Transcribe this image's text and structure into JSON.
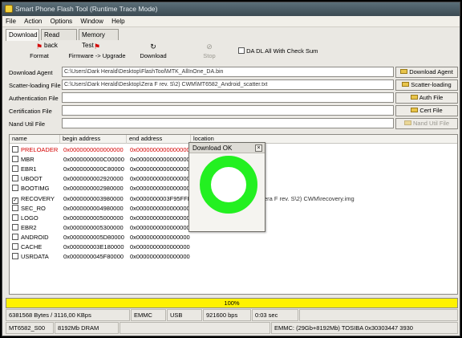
{
  "window": {
    "title": "Smart Phone Flash Tool (Runtime Trace Mode)"
  },
  "menu": [
    "File",
    "Action",
    "Options",
    "Window",
    "Help"
  ],
  "tabs": [
    "Download",
    "Read back",
    "Memory Test"
  ],
  "toolbar": {
    "format": "Format",
    "firmware_upgrade": "Firmware -> Upgrade",
    "download": "Download",
    "stop": "Stop",
    "da_dl_all": "DA DL All With Check Sum"
  },
  "fields": [
    {
      "label": "Download Agent",
      "value": "C:\\Users\\Dark Herald\\Desktop\\FlashTool\\MTK_AllInOne_DA.bin",
      "button": "Download Agent"
    },
    {
      "label": "Scatter-loading File",
      "value": "C:\\Users\\Dark Herald\\Desktop\\Zera F rev. S\\2) CWM\\MT6582_Android_scatter.txt",
      "button": "Scatter-loading"
    },
    {
      "label": "Authentication File",
      "value": "",
      "button": "Auth File"
    },
    {
      "label": "Certification File",
      "value": "",
      "button": "Cert File"
    },
    {
      "label": "Nand Util File",
      "value": "",
      "button": "Nand Util File"
    }
  ],
  "list": {
    "columns": [
      "name",
      "begin address",
      "end address",
      "location"
    ],
    "rows": [
      {
        "name": "PRELOADER",
        "begin": "0x0000000000000000",
        "end": "0x0000000000000000",
        "location": "",
        "checked": false,
        "red": true
      },
      {
        "name": "MBR",
        "begin": "0x0000000000C00000",
        "end": "0x0000000000000000",
        "location": "",
        "checked": false,
        "red": false
      },
      {
        "name": "EBR1",
        "begin": "0x0000000000C80000",
        "end": "0x0000000000000000",
        "location": "",
        "checked": false,
        "red": false
      },
      {
        "name": "UBOOT",
        "begin": "0x0000000002920000",
        "end": "0x0000000000000000",
        "location": "",
        "checked": false,
        "red": false
      },
      {
        "name": "BOOTIMG",
        "begin": "0x0000000002980000",
        "end": "0x0000000000000000",
        "location": "",
        "checked": false,
        "red": false
      },
      {
        "name": "RECOVERY",
        "begin": "0x0000000003980000",
        "end": "0x0000000003F95FFF",
        "location": "op\\Zera F rev. S\\2) CWM\\recovery.img",
        "checked": true,
        "red": false
      },
      {
        "name": "SEC_RO",
        "begin": "0x0000000004980000",
        "end": "0x0000000000000000",
        "location": "",
        "checked": false,
        "red": false
      },
      {
        "name": "LOGO",
        "begin": "0x0000000005000000",
        "end": "0x0000000000000000",
        "location": "",
        "checked": false,
        "red": false
      },
      {
        "name": "EBR2",
        "begin": "0x0000000005300000",
        "end": "0x0000000000000000",
        "location": "",
        "checked": false,
        "red": false
      },
      {
        "name": "ANDROID",
        "begin": "0x0000000005D80000",
        "end": "0x0000000000000000",
        "location": "",
        "checked": false,
        "red": false
      },
      {
        "name": "CACHE",
        "begin": "0x000000003E180000",
        "end": "0x0000000000000000",
        "location": "",
        "checked": false,
        "red": false
      },
      {
        "name": "USRDATA",
        "begin": "0x0000000045F80000",
        "end": "0x0000000000000000",
        "location": "",
        "checked": false,
        "red": false
      }
    ]
  },
  "dialog": {
    "title": "Download OK",
    "ring_color": "#23f021"
  },
  "progress": {
    "text": "100%",
    "value": 1.0,
    "color": "#fff200"
  },
  "status1": {
    "bytes": "6381568 Bytes / 3116,00 KBps",
    "storage": "EMMC",
    "port": "USB",
    "baud": "921600 bps",
    "time": "0:03 sec"
  },
  "status2": {
    "chip": "MT6582_S00",
    "dram": "8192Mb DRAM",
    "emmc": "EMMC: (29Gb+8192Mb) TOSIBA 0x30303447 3930"
  }
}
